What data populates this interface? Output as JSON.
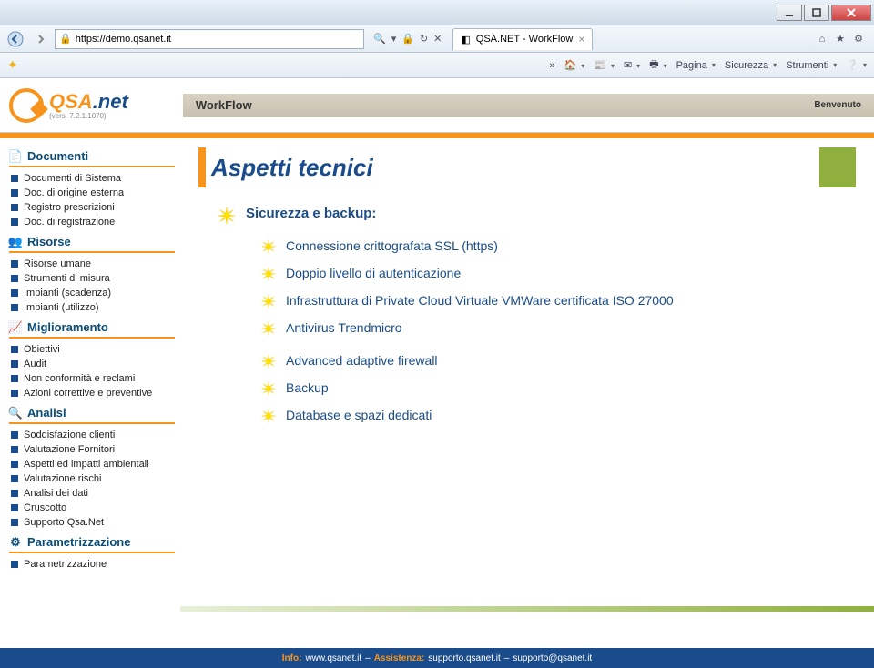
{
  "browser": {
    "url": "https://demo.qsanet.it",
    "tab_title": "QSA.NET - WorkFlow",
    "cmd_page": "Pagina",
    "cmd_security": "Sicurezza",
    "cmd_tools": "Strumenti"
  },
  "app": {
    "version": "(vers. 7.2.1.1070)",
    "section": "WorkFlow",
    "welcome": "Benvenuto"
  },
  "sidebar": [
    {
      "cat": "Documenti",
      "icon": "doc",
      "items": [
        "Documenti di Sistema",
        "Doc. di origine esterna",
        "Registro prescrizioni",
        "Doc. di registrazione"
      ]
    },
    {
      "cat": "Risorse",
      "icon": "people",
      "items": [
        "Risorse umane",
        "Strumenti di misura",
        "Impianti (scadenza)",
        "Impianti (utilizzo)"
      ]
    },
    {
      "cat": "Miglioramento",
      "icon": "chart",
      "items": [
        "Obiettivi",
        "Audit",
        "Non conformità e reclami",
        "Azioni correttive e preventive"
      ]
    },
    {
      "cat": "Analisi",
      "icon": "analysis",
      "items": [
        "Soddisfazione clienti",
        "Valutazione Fornitori",
        "Aspetti ed impatti ambientali",
        "Valutazione rischi",
        "Analisi dei dati",
        "Cruscotto",
        "Supporto Qsa.Net"
      ]
    },
    {
      "cat": "Parametrizzazione",
      "icon": "gear",
      "items": [
        "Parametrizzazione"
      ]
    }
  ],
  "slide": {
    "title": "Aspetti tecnici",
    "heading": "Sicurezza e backup:",
    "bullets": [
      "Connessione crittografata SSL (https)",
      "Doppio livello di autenticazione",
      "Infrastruttura  di  Private Cloud Virtuale VMWare certificata ISO 27000",
      "Antivirus Trendmicro",
      "Advanced adaptive firewall",
      "Backup",
      "Database e spazi dedicati"
    ]
  },
  "footer": {
    "info_label": "Info:",
    "info": "www.qsanet.it",
    "assist_label": "Assistenza:",
    "assist": "supporto.qsanet.it",
    "email": "supporto@qsanet.it"
  }
}
